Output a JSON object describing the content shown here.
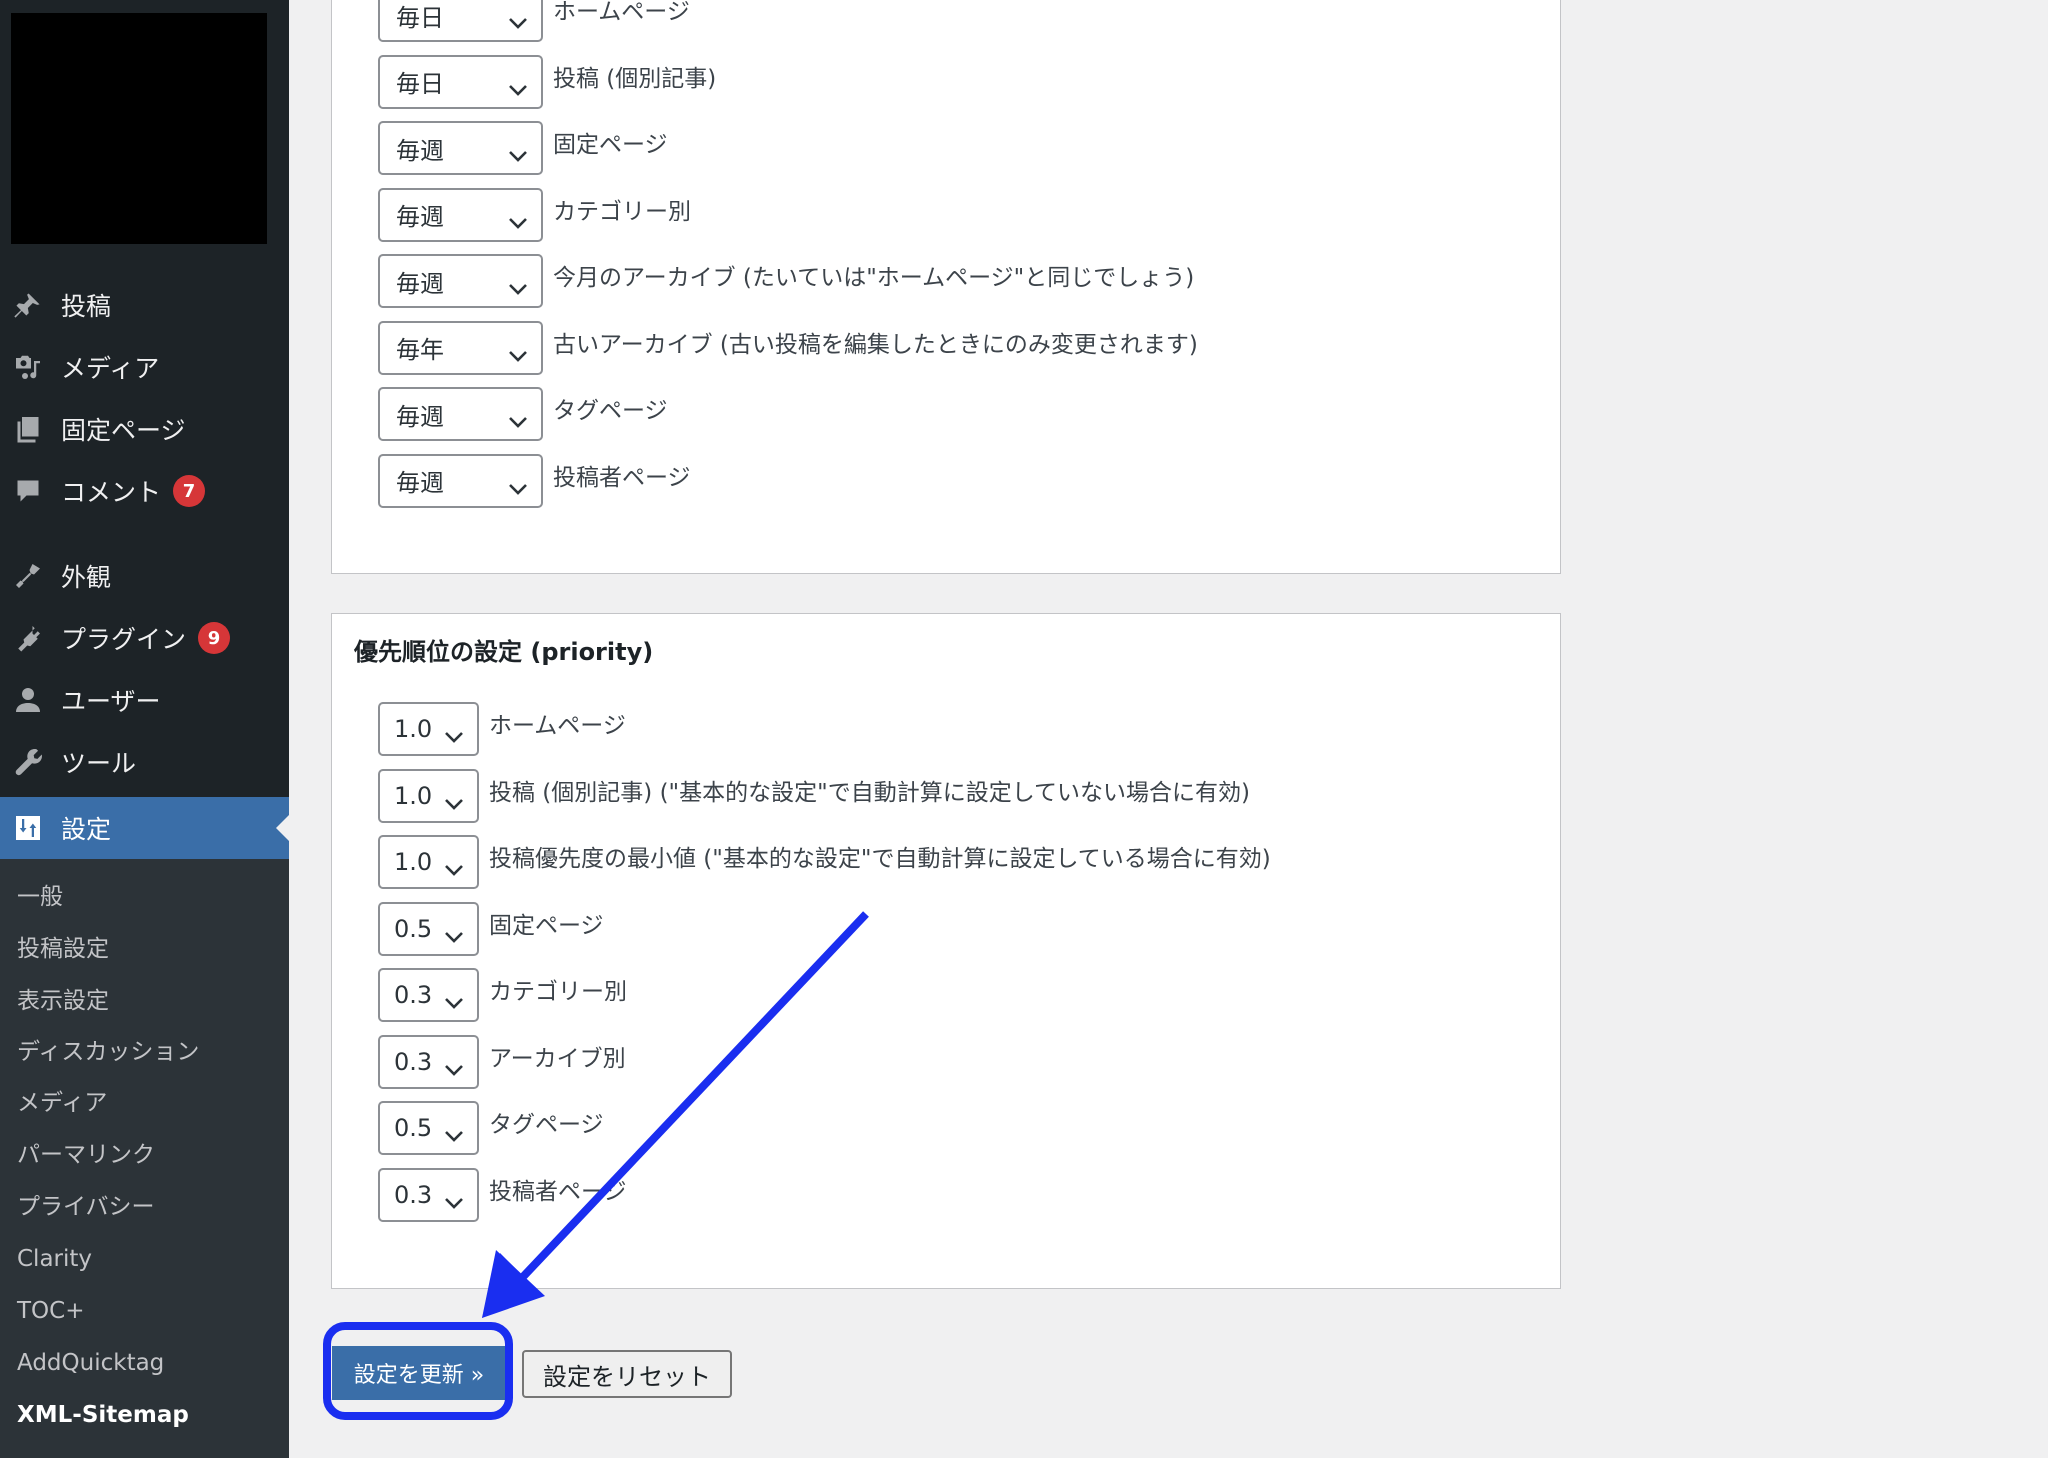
{
  "sidebar": {
    "menu": [
      {
        "label": "投稿",
        "icon": "pin-icon"
      },
      {
        "label": "メディア",
        "icon": "media-icon"
      },
      {
        "label": "固定ページ",
        "icon": "pages-icon"
      },
      {
        "label": "コメント",
        "icon": "comment-icon",
        "badge": "7"
      },
      {
        "label": "外観",
        "icon": "brush-icon"
      },
      {
        "label": "プラグイン",
        "icon": "plugin-icon",
        "badge": "9"
      },
      {
        "label": "ユーザー",
        "icon": "user-icon"
      },
      {
        "label": "ツール",
        "icon": "wrench-icon"
      },
      {
        "label": "設定",
        "icon": "settings-icon",
        "active": true
      }
    ],
    "submenu": [
      "一般",
      "投稿設定",
      "表示設定",
      "ディスカッション",
      "メディア",
      "パーマリンク",
      "プライバシー",
      "Clarity",
      "TOC+",
      "AddQuicktag",
      "XML-Sitemap"
    ],
    "submenu_current": "XML-Sitemap"
  },
  "change_frequency": {
    "rows": [
      {
        "value": "毎日",
        "label": "ホームページ"
      },
      {
        "value": "毎日",
        "label": "投稿 (個別記事)"
      },
      {
        "value": "毎週",
        "label": "固定ページ"
      },
      {
        "value": "毎週",
        "label": "カテゴリー別"
      },
      {
        "value": "毎週",
        "label": "今月のアーカイブ (たいていは\"ホームページ\"と同じでしょう)"
      },
      {
        "value": "毎年",
        "label": "古いアーカイブ (古い投稿を編集したときにのみ変更されます)"
      },
      {
        "value": "毎週",
        "label": "タグページ"
      },
      {
        "value": "毎週",
        "label": "投稿者ページ"
      }
    ]
  },
  "priority": {
    "title": "優先順位の設定 (priority)",
    "rows": [
      {
        "value": "1.0",
        "label": "ホームページ"
      },
      {
        "value": "1.0",
        "label": "投稿 (個別記事) (\"基本的な設定\"で自動計算に設定していない場合に有効)"
      },
      {
        "value": "1.0",
        "label": "投稿優先度の最小値 (\"基本的な設定\"で自動計算に設定している場合に有効)"
      },
      {
        "value": "0.5",
        "label": "固定ページ"
      },
      {
        "value": "0.3",
        "label": "カテゴリー別"
      },
      {
        "value": "0.3",
        "label": "アーカイブ別"
      },
      {
        "value": "0.5",
        "label": "タグページ"
      },
      {
        "value": "0.3",
        "label": "投稿者ページ"
      }
    ]
  },
  "buttons": {
    "update": "設定を更新 »",
    "reset": "設定をリセット"
  },
  "colors": {
    "sidebar_bg": "#1d2327",
    "submenu_bg": "#2c3338",
    "accent": "#3a6ea8",
    "badge": "#d63638",
    "annotation": "#1a2ef0"
  }
}
